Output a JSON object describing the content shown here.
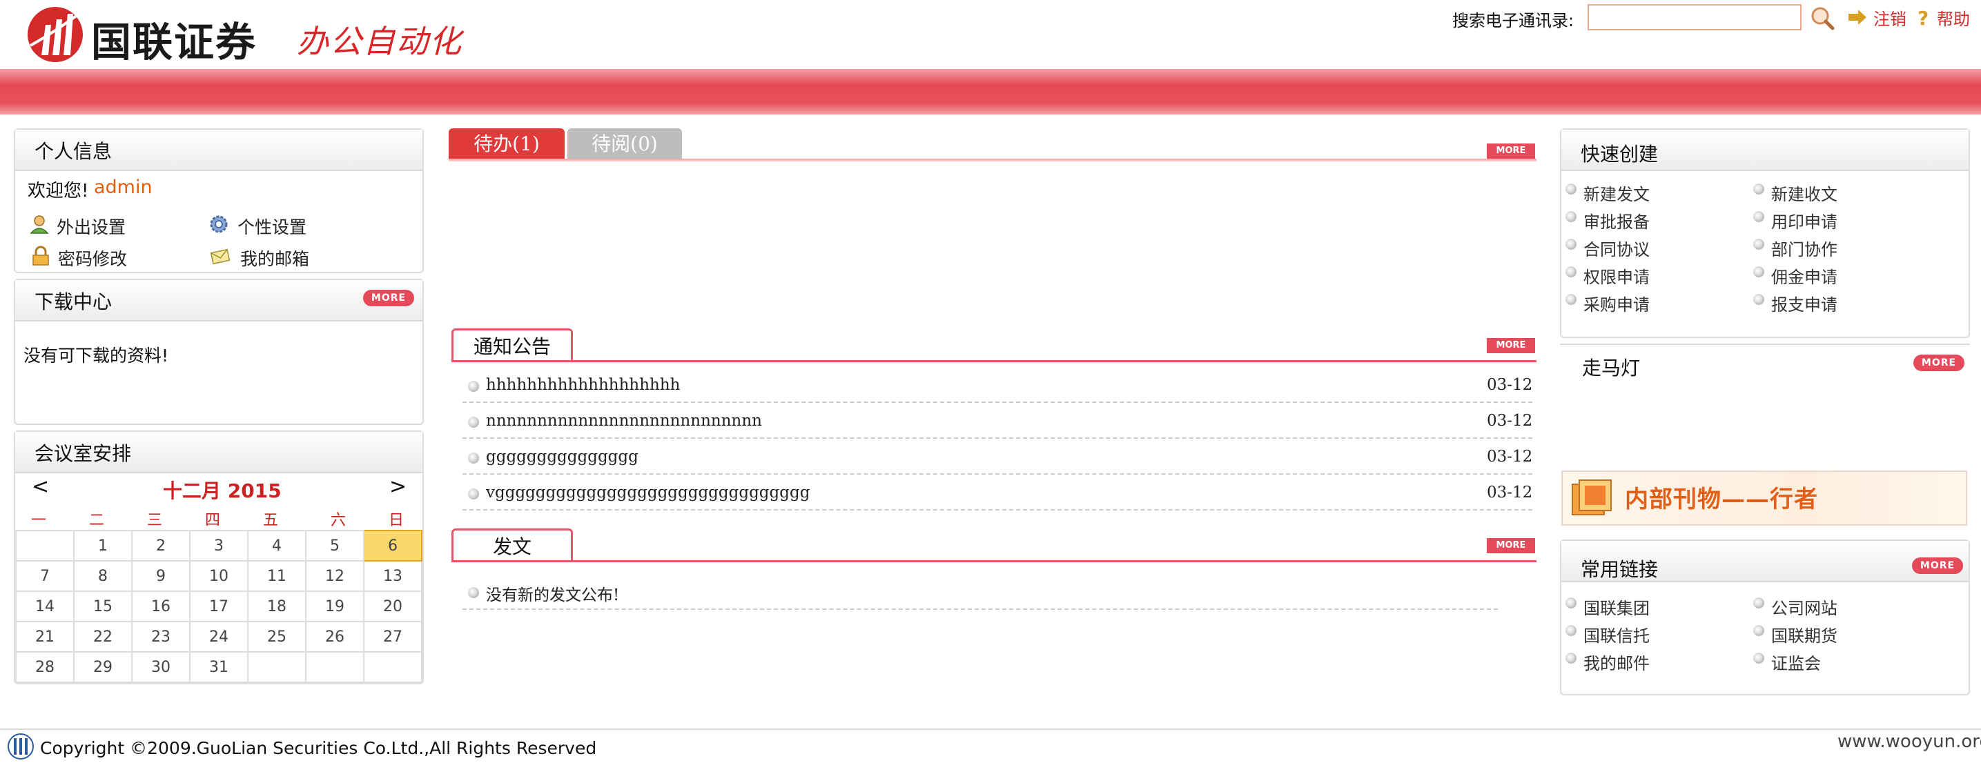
{
  "header": {
    "logo_text": "国联证券",
    "logo_sub": "办公自动化",
    "search_label": "搜索电子通讯录:",
    "search_value": "",
    "logout": "注销",
    "help": "帮助"
  },
  "personal": {
    "title": "个人信息",
    "welcome": "欢迎您!",
    "user": "admin",
    "links": [
      "外出设置",
      "个性设置",
      "密码修改",
      "我的邮箱"
    ]
  },
  "download": {
    "title": "下载中心",
    "more": "MORE",
    "empty": "没有可下载的资料!"
  },
  "meeting": {
    "title": "会议室安排",
    "prev": "<",
    "next": ">",
    "month": "十二月 2015",
    "dow": [
      "一",
      "二",
      "三",
      "四",
      "五",
      "六",
      "日"
    ],
    "weeks": [
      [
        "",
        "1",
        "2",
        "3",
        "4",
        "5",
        "6"
      ],
      [
        "7",
        "8",
        "9",
        "10",
        "11",
        "12",
        "13"
      ],
      [
        "14",
        "15",
        "16",
        "17",
        "18",
        "19",
        "20"
      ],
      [
        "21",
        "22",
        "23",
        "24",
        "25",
        "26",
        "27"
      ],
      [
        "28",
        "29",
        "30",
        "31",
        "",
        "",
        ""
      ]
    ],
    "today": "6"
  },
  "tabs": {
    "todo": "待办(1)",
    "toread": "待阅(0)",
    "more": "MORE"
  },
  "notice": {
    "title": "通知公告",
    "more": "MORE",
    "items": [
      {
        "text": "hhhhhhhhhhhhhhhhhhh",
        "date": "03-12"
      },
      {
        "text": "nnnnnnnnnnnnnnnnnnnnnnnnnnn",
        "date": "03-12"
      },
      {
        "text": "ggggggggggggggg",
        "date": "03-12"
      },
      {
        "text": "vggggggggggggggggggggggggggggggg",
        "date": "03-12"
      }
    ]
  },
  "dispatch": {
    "title": "发文",
    "more": "MORE",
    "empty": "没有新的发文公布!"
  },
  "quick": {
    "title": "快速创建",
    "items": [
      "新建发文",
      "新建收文",
      "审批报备",
      "用印申请",
      "合同协议",
      "部门协作",
      "权限申请",
      "佣金申请",
      "采购申请",
      "报支申请"
    ]
  },
  "marquee": {
    "title": "走马灯",
    "more": "MORE"
  },
  "banner": {
    "text": "内部刊物——行者"
  },
  "links": {
    "title": "常用链接",
    "more": "MORE",
    "items": [
      "国联集团",
      "公司网站",
      "国联信托",
      "国联期货",
      "我的邮件",
      "证监会"
    ]
  },
  "footer": {
    "copyright": "Copyright ©2009.GuoLian Securities Co.Ltd.,All Rights Reserved",
    "watermark": "www.wooyun.org"
  },
  "colors": {
    "brand_red": "#e03a3a",
    "accent_orange": "#e06010"
  }
}
